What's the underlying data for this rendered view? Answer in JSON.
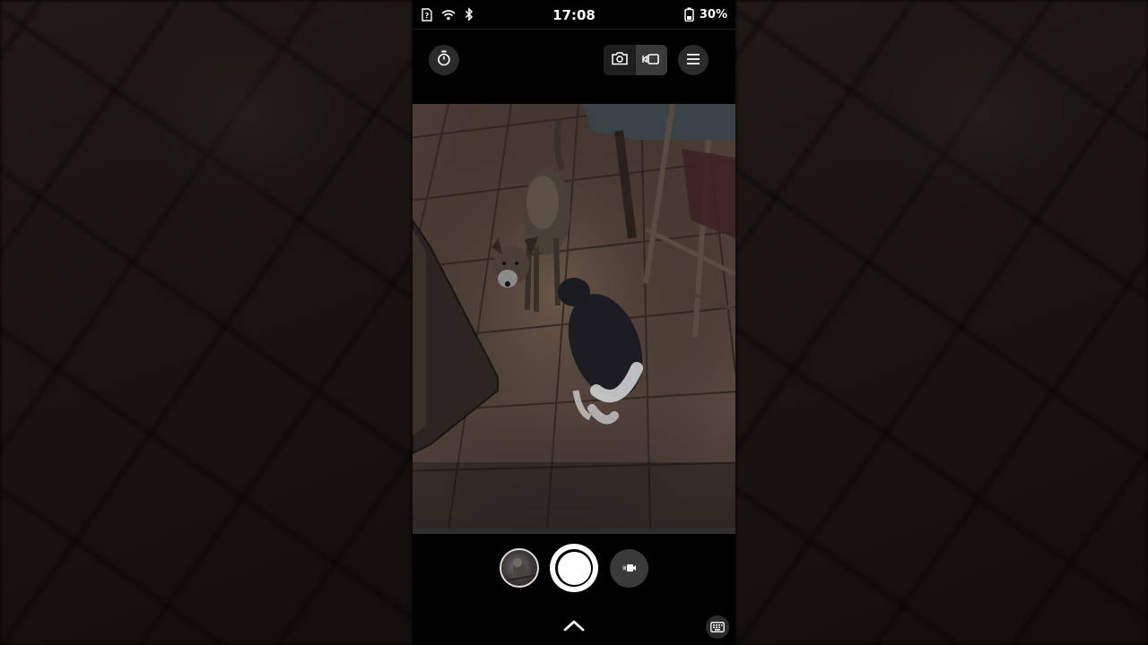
{
  "status_bar": {
    "time": "17:08",
    "battery_percent": "30%",
    "icons": [
      "sim-unknown-icon",
      "wifi-icon",
      "bluetooth-icon",
      "battery-icon"
    ]
  },
  "camera_controls": {
    "timer_icon": "timer-icon",
    "mode_options": [
      "photo-icon",
      "video-mode-icon"
    ],
    "active_mode": "video-mode-icon",
    "menu_icon": "menu-icon"
  },
  "bottom_controls": {
    "gallery_thumbnail": "last-capture-thumbnail",
    "shutter": "shutter-button",
    "record_icon": "video-camera-icon",
    "expand_icon": "chevron-up-icon",
    "keyboard_icon": "keyboard-icon"
  },
  "colors": {
    "accent": "#ffffff",
    "button_bg": "#2b2b2b",
    "active_segment": "#3a3a3a"
  }
}
